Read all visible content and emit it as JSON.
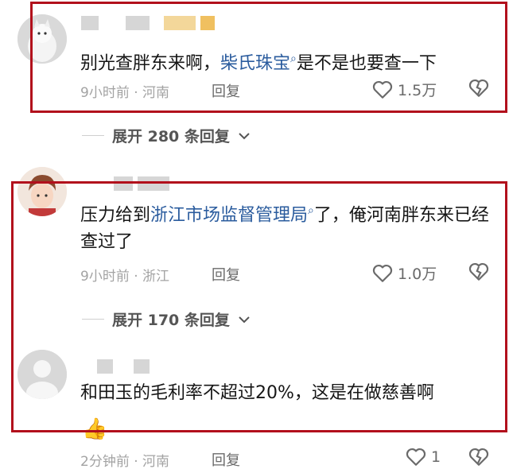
{
  "comments": [
    {
      "text_before": "别光查胖东来啊，",
      "link": "柴氏珠宝",
      "text_after": "是不是也要查一下",
      "time": "9小时前 · 河南",
      "reply": "回复",
      "likes": "1.5万"
    },
    {
      "text_before": "压力给到",
      "link": "浙江市场监督管理局",
      "text_after": "了，俺河南胖东来已经查过了",
      "time": "9小时前 · 浙江",
      "reply": "回复",
      "likes": "1.0万"
    },
    {
      "text": "和田玉的毛利率不超过20%，这是在做慈善啊",
      "time": "2分钟前 · 河南",
      "reply": "回复",
      "likes": "1"
    }
  ],
  "expand_1": "展开 280 条回复",
  "expand_2": "展开 170 条回复",
  "colors": {
    "link": "#2b5c9e",
    "highlight_box": "#b2101c"
  },
  "icons": [
    "heart-icon",
    "broken-heart-icon",
    "search-icon",
    "chevron-down-icon",
    "thumbs-up-emoji"
  ]
}
